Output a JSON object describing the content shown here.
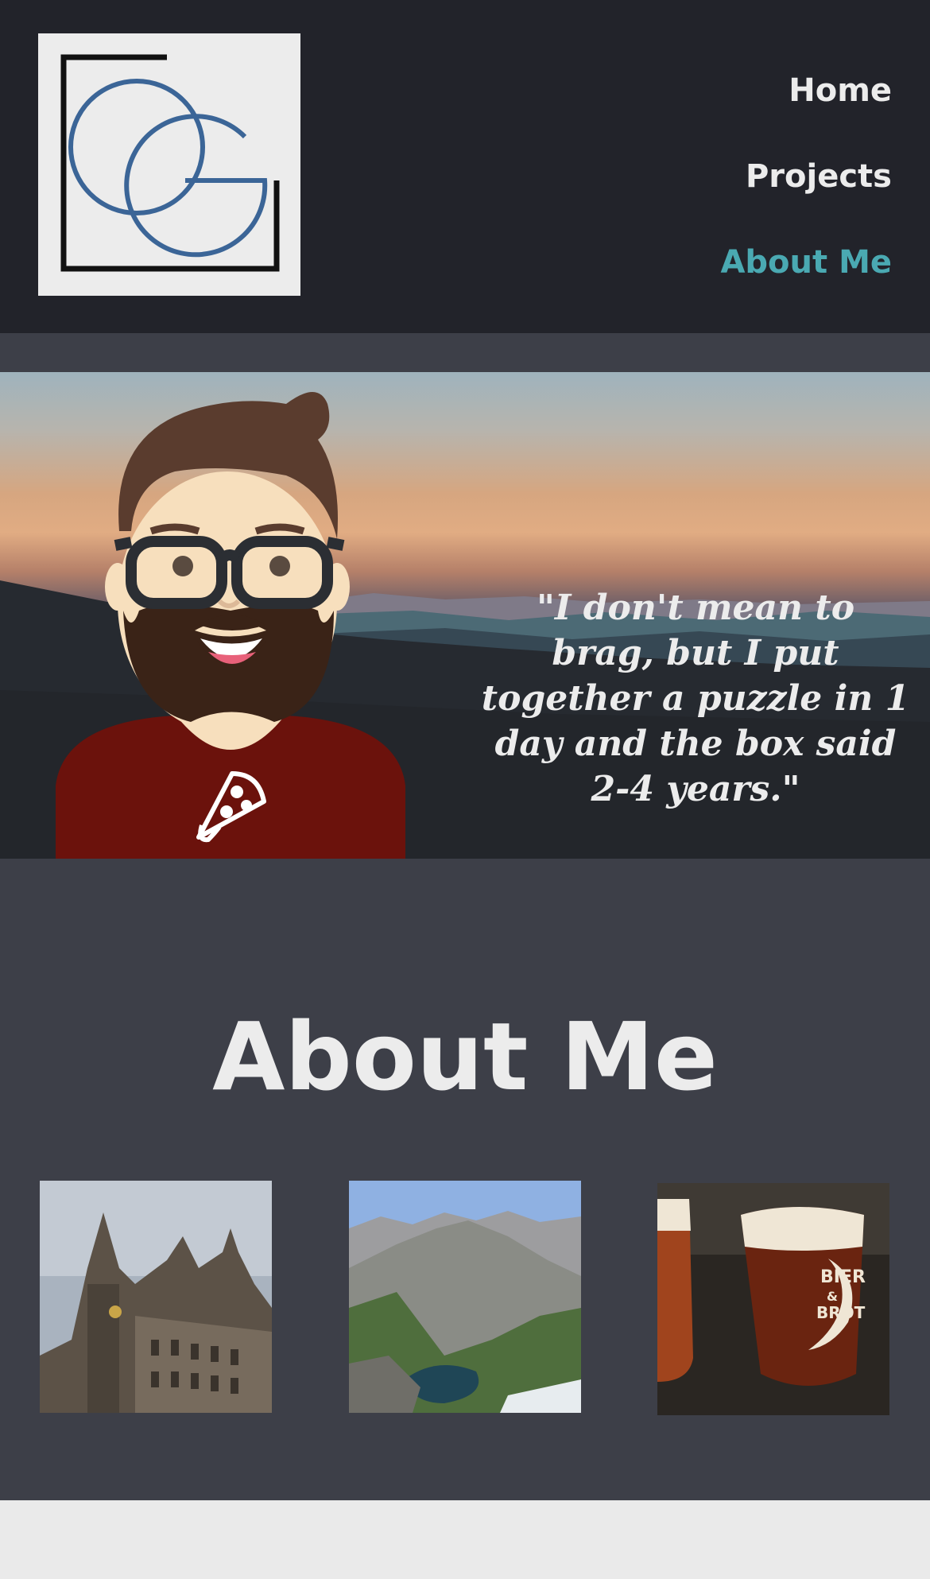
{
  "nav": {
    "items": [
      {
        "label": "Home",
        "active": false
      },
      {
        "label": "Projects",
        "active": false
      },
      {
        "label": "About Me",
        "active": true
      }
    ]
  },
  "hero": {
    "quote": "\"I don't mean to brag, but I put together a puzzle in 1 day and the box said 2-4 years.\""
  },
  "about": {
    "title": "About Me"
  },
  "photos": {
    "beer_glass_text_1": "BIER",
    "beer_glass_text_2": "&",
    "beer_glass_text_3": "BROT"
  },
  "colors": {
    "header_bg": "#22232a",
    "page_bg": "#3d3f48",
    "nav_active": "#4aa9b2",
    "text": "#ececec",
    "footer_bg": "#eaeaea"
  }
}
